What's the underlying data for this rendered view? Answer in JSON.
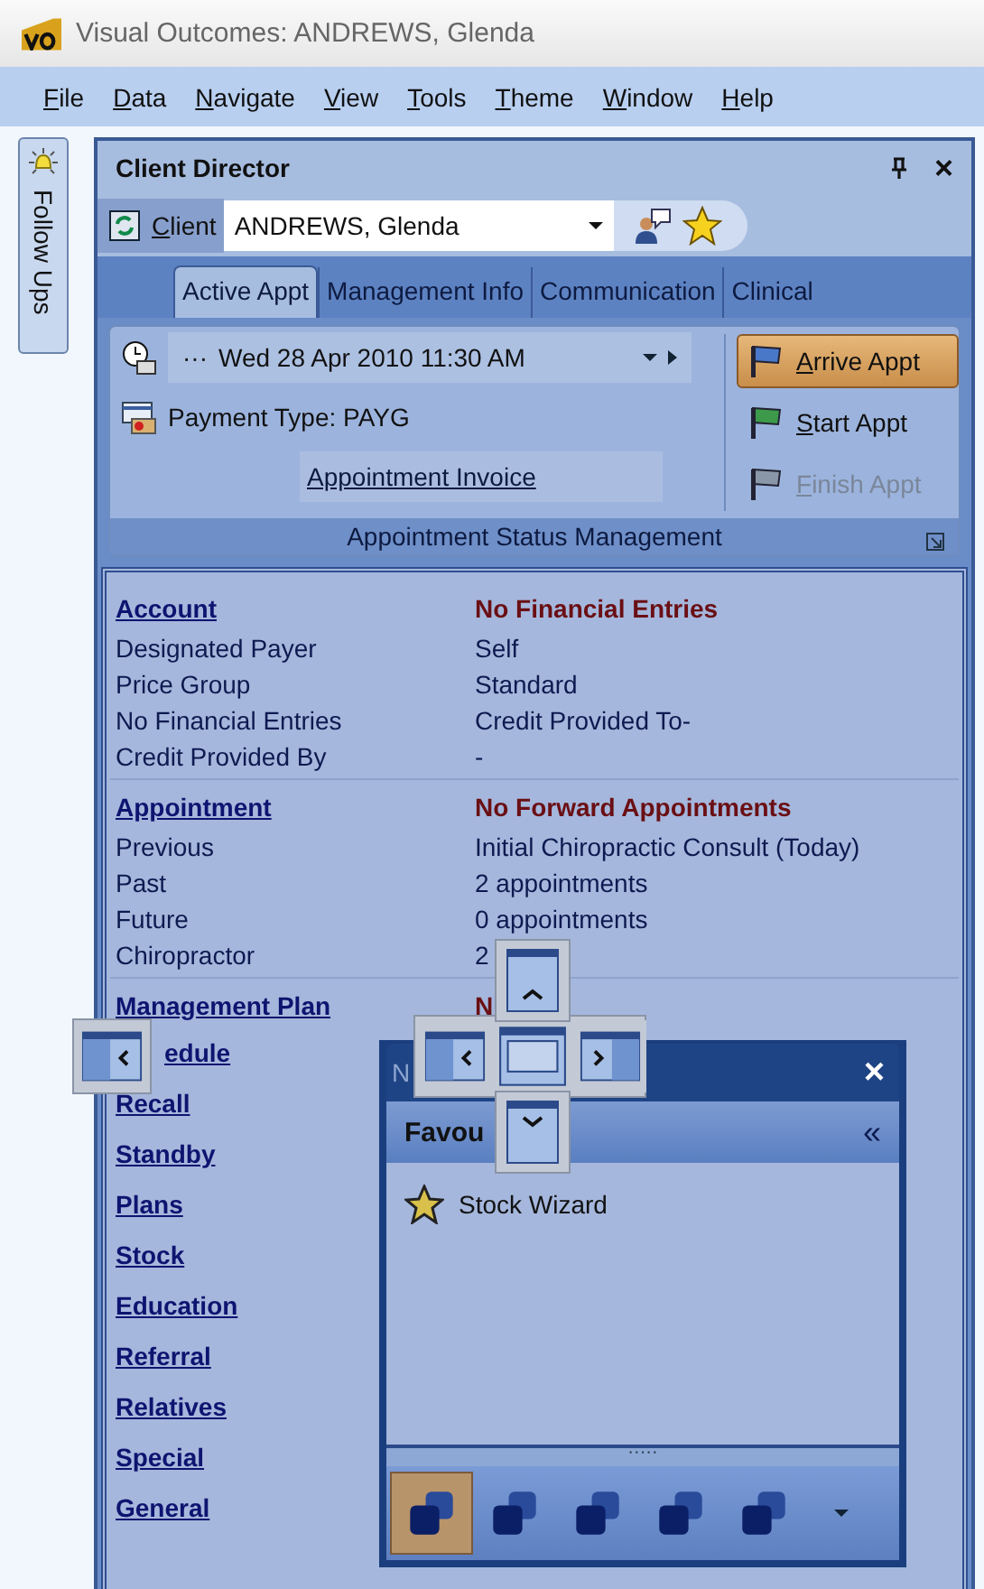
{
  "window": {
    "title": "Visual Outcomes: ANDREWS, Glenda"
  },
  "menu": [
    "File",
    "Data",
    "Navigate",
    "View",
    "Tools",
    "Theme",
    "Window",
    "Help"
  ],
  "side_tab": {
    "label": "Follow Ups"
  },
  "panel": {
    "title": "Client Director",
    "close": "×"
  },
  "client": {
    "label": "Client",
    "value": "ANDREWS, Glenda"
  },
  "tabs": [
    {
      "label": "Active Appt",
      "selected": true
    },
    {
      "label": "Management Info",
      "selected": false
    },
    {
      "label": "Communication",
      "selected": false
    },
    {
      "label": "Clinical",
      "selected": false
    }
  ],
  "appointment": {
    "dots": "···",
    "date": "Wed 28 Apr 2010 11:30 AM",
    "payment": "Payment Type: PAYG",
    "invoice_link": "Appointment Invoice",
    "group_label": "Appointment Status Management"
  },
  "actions": [
    {
      "label": "Arrive Appt",
      "highlighted": true,
      "disabled": false,
      "color": "#4a78c8"
    },
    {
      "label": "Start Appt",
      "highlighted": false,
      "disabled": false,
      "color": "#3c9a4a"
    },
    {
      "label": "Finish Appt",
      "highlighted": false,
      "disabled": true,
      "color": "#8a97a8"
    }
  ],
  "details": [
    {
      "kind": "heading",
      "label": "Account",
      "value": "No Financial Entries"
    },
    {
      "kind": "field",
      "label": "Designated Payer",
      "value": "Self"
    },
    {
      "kind": "field",
      "label": "Price Group",
      "value": "Standard"
    },
    {
      "kind": "field",
      "label": "No Financial Entries",
      "value": "Credit Provided To-"
    },
    {
      "kind": "field",
      "label": "Credit Provided By",
      "value": "-"
    },
    {
      "kind": "divider"
    },
    {
      "kind": "heading",
      "label": "Appointment",
      "value": "No Forward Appointments"
    },
    {
      "kind": "field",
      "label": "Previous",
      "value": "Initial Chiropractic Consult (Today)"
    },
    {
      "kind": "field",
      "label": "Past",
      "value": "2 appointments"
    },
    {
      "kind": "field",
      "label": "Future",
      "value": "0 appointments"
    },
    {
      "kind": "field",
      "label": "Chiropractor",
      "value": "2"
    },
    {
      "kind": "divider"
    },
    {
      "kind": "heading",
      "label": "Management Plan",
      "value": "N"
    },
    {
      "kind": "link",
      "label": "edule",
      "covered": true
    },
    {
      "kind": "link",
      "label": "Recall",
      "covered": false
    },
    {
      "kind": "link",
      "label": "Standby",
      "covered": false
    },
    {
      "kind": "link",
      "label": "Plans",
      "covered": false
    },
    {
      "kind": "link",
      "label": "Stock",
      "covered": false
    },
    {
      "kind": "link",
      "label": "Education",
      "covered": false
    },
    {
      "kind": "link",
      "label": "Referral",
      "covered": false
    },
    {
      "kind": "link",
      "label": "Relatives",
      "covered": false
    },
    {
      "kind": "link",
      "label": "Special",
      "covered": false
    },
    {
      "kind": "link",
      "label": "General",
      "covered": false
    }
  ],
  "floating_panel": {
    "title": "N",
    "close": "×",
    "header": "Favou",
    "collapse": "«",
    "items": [
      {
        "label": "Stock Wizard"
      }
    ],
    "grip": "·····",
    "bottom_buttons": [
      {
        "selected": true
      },
      {
        "selected": false
      },
      {
        "selected": false
      },
      {
        "selected": false
      },
      {
        "selected": false
      }
    ]
  }
}
